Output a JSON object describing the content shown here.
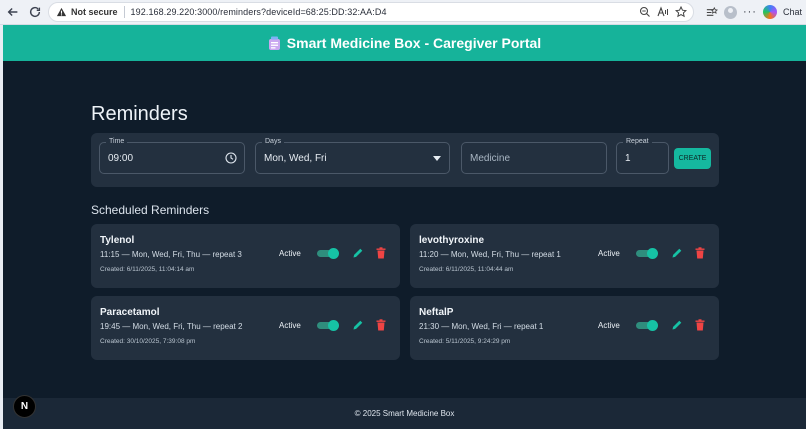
{
  "browser": {
    "security_label": "Not secure",
    "url": "192.168.29.220:3000/reminders?deviceId=68:25:DD:32:AA:D4",
    "chat_label": "Chat"
  },
  "header": {
    "title": "Smart Medicine Box - Caregiver Portal"
  },
  "page": {
    "title": "Reminders",
    "section_title": "Scheduled Reminders"
  },
  "form": {
    "time_label": "Time",
    "time_value": "09:00",
    "days_label": "Days",
    "days_value": "Mon, Wed, Fri",
    "medicine_placeholder": "Medicine",
    "repeat_label": "Repeat",
    "repeat_value": "1",
    "create_label": "CREATE"
  },
  "reminders": [
    {
      "name": "Tylenol",
      "schedule": "11:15 — Mon, Wed, Fri, Thu — repeat 3",
      "created": "Created: 6/11/2025, 11:04:14 am",
      "status": "Active"
    },
    {
      "name": "levothyroxine",
      "schedule": "11:20 — Mon, Wed, Fri, Thu — repeat 1",
      "created": "Created: 6/11/2025, 11:04:44 am",
      "status": "Active"
    },
    {
      "name": "Paracetamol",
      "schedule": "19:45 — Mon, Wed, Fri, Thu — repeat 2",
      "created": "Created: 30/10/2025, 7:39:08 pm",
      "status": "Active"
    },
    {
      "name": "NeftalP",
      "schedule": "21:30 — Mon, Wed, Fri — repeat 1",
      "created": "Created: 5/11/2025, 9:24:29 pm",
      "status": "Active"
    }
  ],
  "footer": {
    "text": "© 2025 Smart Medicine Box"
  },
  "dev_badge": "N",
  "colors": {
    "accent": "#16b39a",
    "background": "#0f1c2a",
    "card": "#23303f",
    "delete": "#ef4444"
  }
}
